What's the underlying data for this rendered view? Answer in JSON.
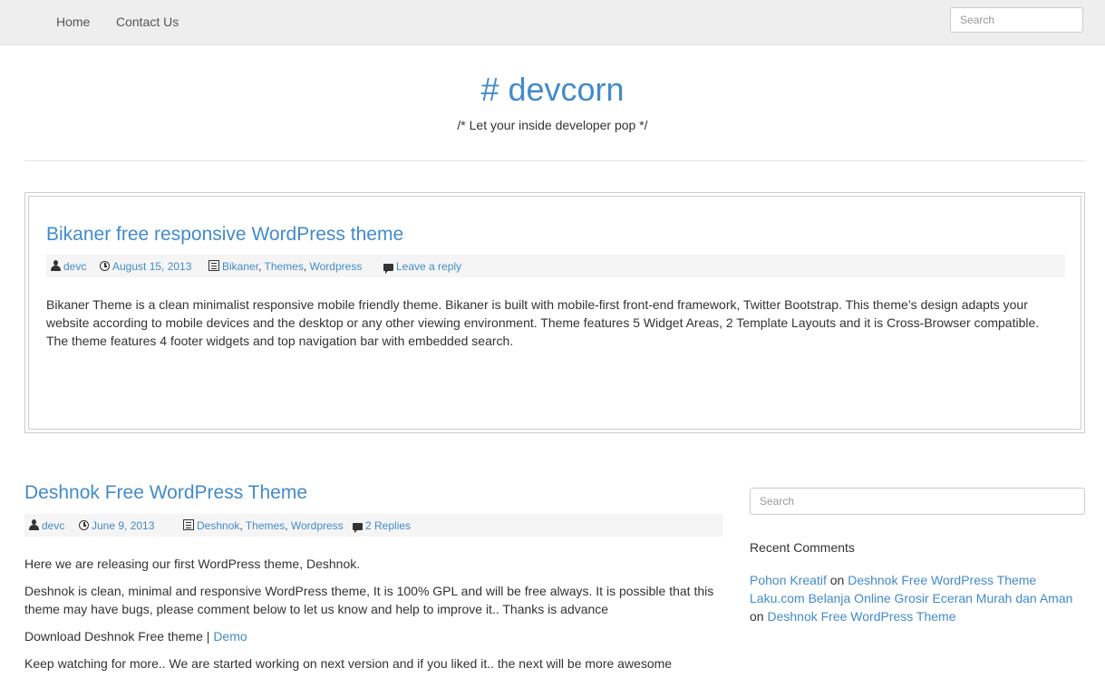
{
  "nav": {
    "items": [
      "Home",
      "Contact Us"
    ],
    "search_placeholder": "Search"
  },
  "header": {
    "title": "# devcorn",
    "description": "/* Let your inside developer pop */"
  },
  "featured": {
    "title": "Bikaner free responsive WordPress theme",
    "meta": {
      "author": "devc",
      "date": "August 15, 2013",
      "categories": [
        "Bikaner",
        "Themes",
        "Wordpress"
      ],
      "comments": "Leave a reply"
    },
    "excerpt_lines": [
      "Bikaner Theme is a clean minimalist responsive mobile friendly theme. Bikaner is built with mobile-first front-end framework, Twitter Bootstrap. This theme’s design adapts your",
      "website according to mobile devices and the desktop or any other viewing environment. Theme features 5 Widget Areas, 2 Template Layouts and it is Cross-Browser compatible.",
      "The theme features 4 footer widgets and top navigation bar with embedded search."
    ]
  },
  "post": {
    "title": "Deshnok Free WordPress Theme",
    "meta": {
      "author": "devc",
      "date": "June 9, 2013",
      "categories": [
        "Deshnok",
        "Themes",
        "Wordpress"
      ],
      "comments": "2 Replies"
    },
    "paragraph_1": "Here we are releasing our first WordPress theme, Deshnok.",
    "paragraph_2_lines": [
      "Deshnok is clean, minimal and responsive WordPress theme, It is 100% GPL and will be free always.  It is possible that this",
      "theme may have bugs, please comment below to let us know and help to improve it.. Thanks is advance"
    ],
    "download_text": "Download Deshnok Free theme |",
    "demo_link": "Demo",
    "paragraph_4": "Keep watching for more.. We are started working on next version and if you liked it.. the next will be more awesome"
  },
  "sidebar": {
    "search_placeholder": "Search",
    "recent_comments_heading": "Recent Comments",
    "recent_comments": [
      {
        "author": "Pohon Kreatif",
        "on": "on",
        "post": "Deshnok Free WordPress Theme"
      },
      {
        "author": "Laku.com Belanja Online Grosir Eceran Murah dan Aman",
        "on": "on",
        "post": "Deshnok Free WordPress Theme"
      }
    ]
  },
  "colors": {
    "link": "#428bca",
    "navbar_bg": "#eeeeee",
    "meta_bg": "#f5f5f5",
    "text": "#333333"
  }
}
